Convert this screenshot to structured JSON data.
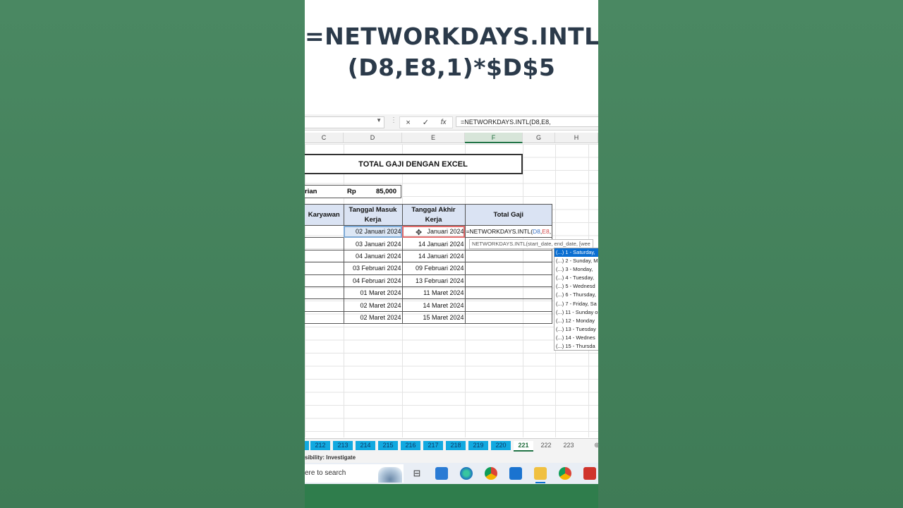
{
  "overlay_title": {
    "line1": "=NETWORKDAYS.INTL",
    "line2": "(D8,E8,1)*$D$5"
  },
  "formula_bar": {
    "cancel_icon": "×",
    "enter_icon": "✓",
    "fx_label": "fx",
    "formula_text": "=NETWORKDAYS.INTL(D8,E8,"
  },
  "columns": [
    "C",
    "D",
    "E",
    "F",
    "G",
    "H"
  ],
  "sheet": {
    "title": "TOTAL GAJI DENGAN EXCEL",
    "rate_label": "rian",
    "rate_currency": "Rp",
    "rate_value": "85,000",
    "headers": {
      "c": "Karyawan",
      "d": "Tanggal Masuk Kerja",
      "e": "Tanggal Akhir Kerja",
      "f": "Total Gaji"
    },
    "rows": [
      {
        "d": "02 Januari 2024",
        "e": "Januari 2024",
        "f": "=NETWORKDAYS.INTL(D8,E8,"
      },
      {
        "d": "03 Januari 2024",
        "e": "14 Januari 2024",
        "f": ""
      },
      {
        "d": "04 Januari 2024",
        "e": "14 Januari 2024",
        "f": ""
      },
      {
        "d": "03 Februari 2024",
        "e": "09 Februari 2024",
        "f": ""
      },
      {
        "d": "04 Februari 2024",
        "e": "13 Februari 2024",
        "f": ""
      },
      {
        "d": "01 Maret 2024",
        "e": "11 Maret 2024",
        "f": ""
      },
      {
        "d": "02 Maret 2024",
        "e": "14 Maret 2024",
        "f": ""
      },
      {
        "d": "02 Maret 2024",
        "e": "15 Maret 2024",
        "f": ""
      }
    ],
    "edit_cell": {
      "prefix": "=NETWORKDAYS.INTL(",
      "ref1": "D8",
      "sep1": ",",
      "ref2": "E8",
      "sep2": ","
    }
  },
  "tooltip": "NETWORKDAYS.INTL(start_date, end_date, [wee",
  "weekend_options": [
    "(...) 1 - Saturday,",
    "(...) 2 - Sunday, M",
    "(...) 3 - Monday,",
    "(...) 4 - Tuesday,",
    "(...) 5 - Wednesd",
    "(...) 6 - Thursday,",
    "(...) 7 - Friday, Sa",
    "(...) 11 - Sunday o",
    "(...) 12 - Monday",
    "(...) 13 - Tuesday",
    "(...) 14 - Wednes",
    "(...) 15 - Thursda"
  ],
  "sheet_tabs": [
    "212",
    "213",
    "214",
    "215",
    "216",
    "217",
    "218",
    "219",
    "220",
    "221",
    "222",
    "223"
  ],
  "active_tab": "221",
  "status_text": "sibility: Investigate",
  "taskbar": {
    "search_text": "ere to search"
  },
  "colors": {
    "accent": "#217346",
    "tab_blue": "#12a9e0",
    "header_fill": "#dae3f3",
    "selection": "#0a6ed1"
  }
}
